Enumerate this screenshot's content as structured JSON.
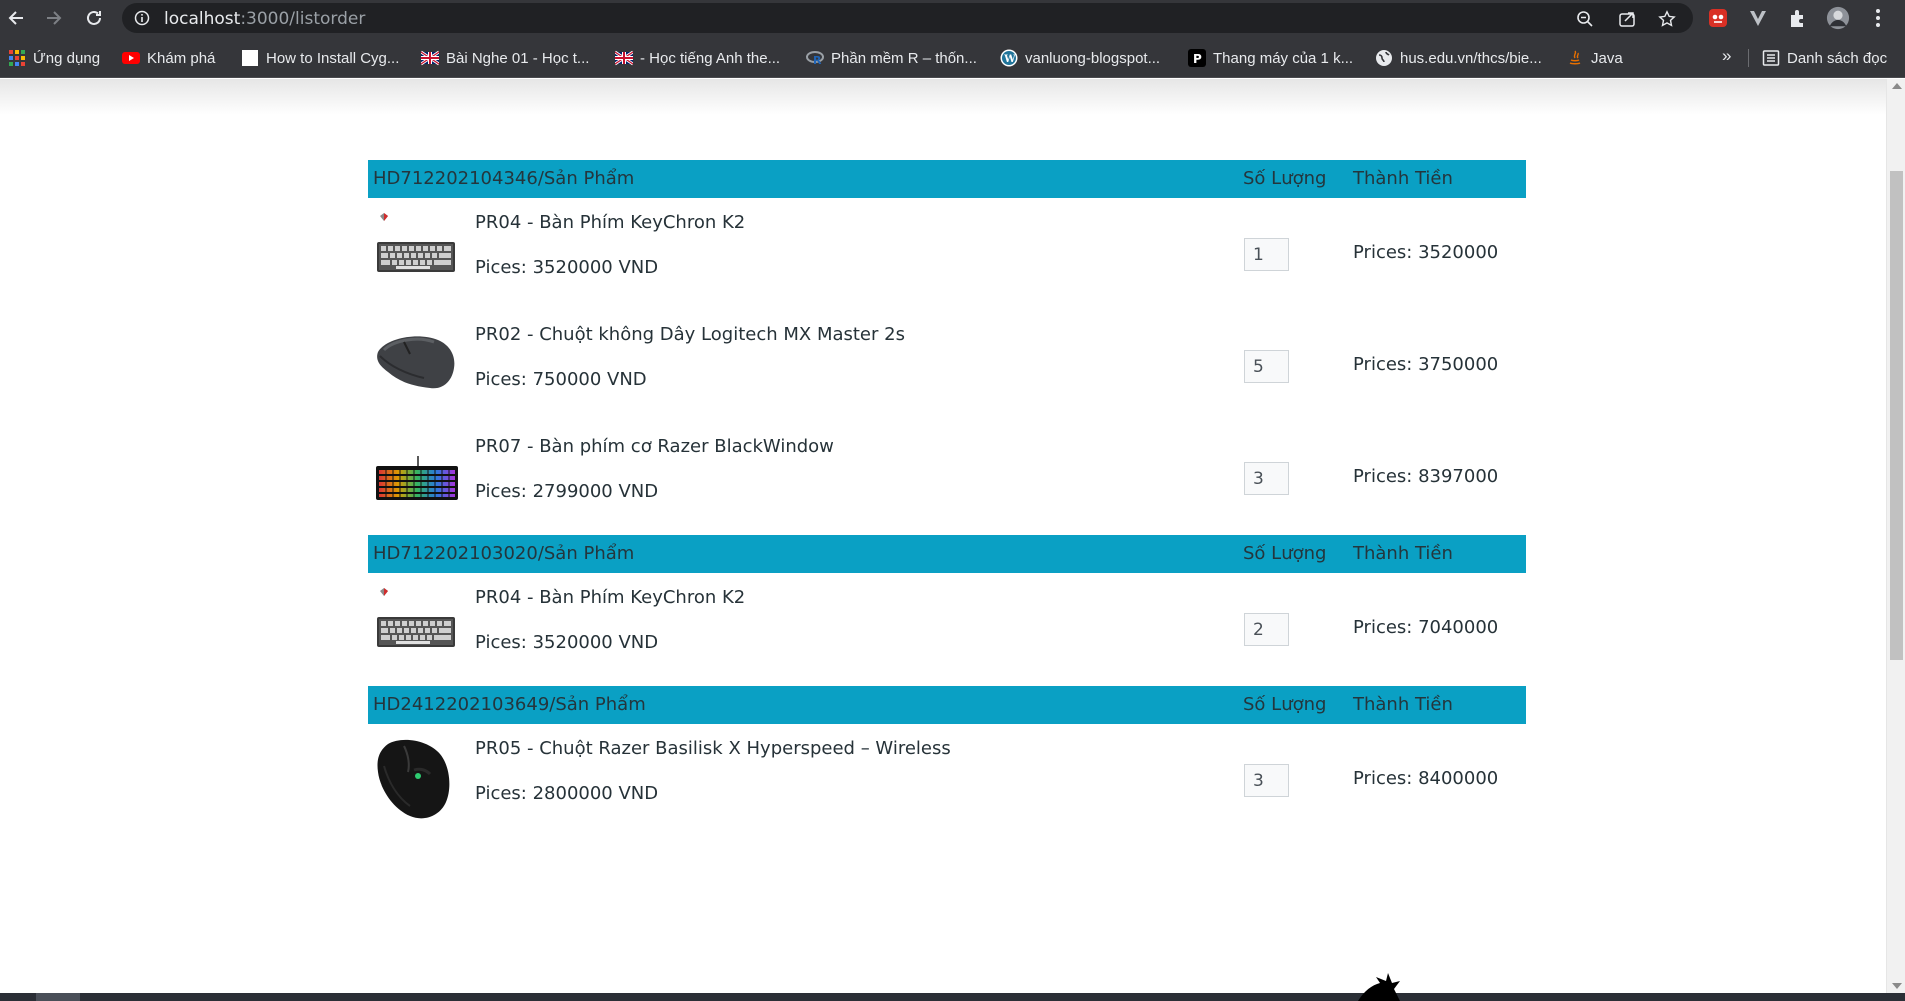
{
  "browser": {
    "url_host": "localhost",
    "url_path": ":3000/listorder",
    "icons": {
      "back": "arrow-left-icon",
      "forward": "arrow-right-icon",
      "reload": "reload-icon",
      "info": "info-icon",
      "zoom": "zoom-icon",
      "share": "share-icon",
      "bookmark": "star-icon",
      "extensions": "puzzle-icon",
      "menu": "kebab-menu-icon"
    }
  },
  "bookmarks": {
    "items": [
      {
        "label": "Ứng dụng",
        "icon": "apps-grid-icon"
      },
      {
        "label": "Khám phá",
        "icon": "youtube-icon"
      },
      {
        "label": "How to Install Cyg...",
        "icon": "blank-page-icon"
      },
      {
        "label": "Bài Nghe 01 - Học t...",
        "icon": "uk-flag-icon"
      },
      {
        "label": "- Học tiếng Anh the...",
        "icon": "uk-flag-icon"
      },
      {
        "label": "Phần mềm R – thốn...",
        "icon": "r-logo-icon"
      },
      {
        "label": "vanluong-blogspot...",
        "icon": "wordpress-icon"
      },
      {
        "label": "Thang máy của 1 k...",
        "icon": "p-logo-icon"
      },
      {
        "label": "hus.edu.vn/thcs/bie...",
        "icon": "globe-icon"
      },
      {
        "label": "Java",
        "icon": "java-icon"
      }
    ],
    "more": "»",
    "reading_list": "Danh sách đọc"
  },
  "orders": [
    {
      "header_id": "HD712202104346/Sản Phẩm",
      "header_qty": "Số Lượng",
      "header_total": "Thành Tiền",
      "items": [
        {
          "name": "PR04 - Bàn Phím KeyChron K2",
          "price": "Pices: 3520000 VND",
          "qty": "1",
          "total": "Prices: 3520000",
          "image": "keyboard-keychron-image"
        },
        {
          "name": "PR02 - Chuột không Dây Logitech MX Master 2s",
          "price": "Pices: 750000 VND",
          "qty": "5",
          "total": "Prices: 3750000",
          "image": "mouse-logitech-image"
        },
        {
          "name": "PR07 - Bàn phím cơ Razer BlackWindow",
          "price": "Pices: 2799000 VND",
          "qty": "3",
          "total": "Prices: 8397000",
          "image": "keyboard-razer-image"
        }
      ]
    },
    {
      "header_id": "HD712202103020/Sản Phẩm",
      "header_qty": "Số Lượng",
      "header_total": "Thành Tiền",
      "items": [
        {
          "name": "PR04 - Bàn Phím KeyChron K2",
          "price": "Pices: 3520000 VND",
          "qty": "2",
          "total": "Prices: 7040000",
          "image": "keyboard-keychron-image"
        }
      ]
    },
    {
      "header_id": "HD2412202103649/Sản Phẩm",
      "header_qty": "Số Lượng",
      "header_total": "Thành Tiền",
      "items": [
        {
          "name": "PR05 - Chuột Razer Basilisk X Hyperspeed – Wireless",
          "price": "Pices: 2800000 VND",
          "qty": "3",
          "total": "Prices: 8400000",
          "image": "mouse-razer-image"
        }
      ]
    }
  ],
  "colors": {
    "header_bg": "#0aa0c4",
    "chrome_bg": "#35363a"
  }
}
